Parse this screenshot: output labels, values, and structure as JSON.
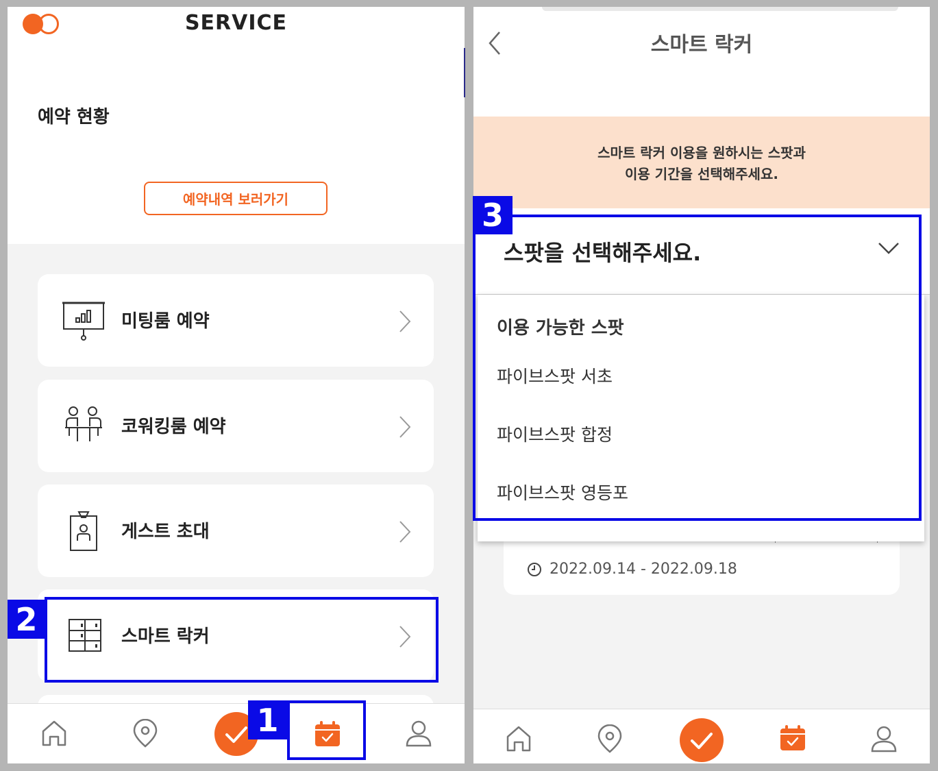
{
  "left_screen": {
    "header": {
      "title": "SERVICE",
      "logo": "two-circles-logo"
    },
    "reservation": {
      "title": "예약 현황",
      "button_label": "예약내역 보러가기"
    },
    "menu": [
      {
        "label": "미팅룸 예약",
        "icon": "presentation-board-icon"
      },
      {
        "label": "코워킹룸 예약",
        "icon": "people-desk-icon"
      },
      {
        "label": "게스트 초대",
        "icon": "guest-badge-icon"
      },
      {
        "label": "스마트 락커",
        "icon": "locker-icon"
      }
    ],
    "nav": [
      "home-icon",
      "location-icon",
      "check-icon",
      "calendar-icon",
      "user-icon"
    ]
  },
  "right_screen": {
    "header": {
      "title": "스마트 락커",
      "back_icon": "chevron-left-icon"
    },
    "notice": {
      "line1": "스마트 락커 이용을 원하시는 스팟과",
      "line2": "이용 기간을 선택해주세요."
    },
    "spot_select": {
      "placeholder": "스팟을 선택해주세요."
    },
    "dropdown": {
      "header": "이용 가능한 스팟",
      "options": [
        "파이브스팟 서초",
        "파이브스팟 합정",
        "파이브스팟 영등포"
      ]
    },
    "date_range": "2022.09.14 - 2022.09.18",
    "nav": [
      "home-icon",
      "location-icon",
      "check-icon",
      "calendar-icon",
      "user-icon"
    ]
  },
  "annotations": [
    "1",
    "2",
    "3"
  ],
  "colors": {
    "accent": "#f26522",
    "annotation": "#0a0ae6",
    "notice_bg": "#fce0cc"
  }
}
